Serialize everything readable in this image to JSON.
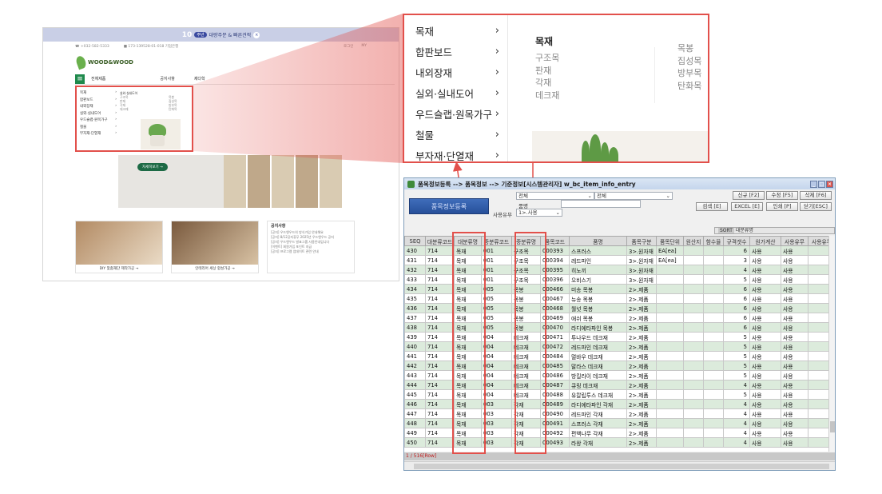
{
  "site": {
    "banner_num": "10",
    "banner_badge": "주년",
    "banner_text": "대량주문 & 빠른견적",
    "banner_close": "×",
    "phone": "☎ +032-582-5333",
    "account": "■ 173-139528-01-018 기업은행",
    "login": "로그인",
    "mypage": "MY",
    "logo_text": "WOOD&WOOD",
    "nav_all": "전체제품",
    "nav_notice": "공지사항",
    "nav_items": "제다학",
    "menu_title": "목재",
    "menu_items": [
      "목재",
      "합판보드",
      "내외장재",
      "실외·실내도어",
      "우드슬랩·원목가구",
      "철물",
      "부자재·단열재"
    ],
    "menu_sub": [
      "실외·실내도어",
      "구조목",
      "판재",
      "각재",
      "데크재"
    ],
    "menu_sub2": [
      "목봉",
      "집성목",
      "방부목",
      "탄화목"
    ],
    "hero_btn": "자세히보기 →",
    "card1": "DIY 맞춤재단 제작가공 →",
    "card2": "인테리어 세상 합성가공 →",
    "notice_title": "공지사항",
    "notices": [
      "[공지] 우드앤우드의 방식가입 안내해요",
      "[공지] 8/12공지휴무 2025년 우드앤우드 공지",
      "[공지] 우드앤우드 발표그룹 사용안내입니다",
      "[이벤트] 회원가입 포인트 지급",
      "[공지] 프로그램 업데이트 관련 안내"
    ]
  },
  "zoom": {
    "categories": [
      "목재",
      "합판보드",
      "내외장재",
      "실외·실내도어",
      "우드슬랩·원목가구",
      "철물",
      "부자재·단열재"
    ],
    "sub_title": "목재",
    "sub_items": [
      "구조목",
      "판재",
      "각재",
      "데크재"
    ],
    "sub_items2": [
      "목봉",
      "집성목",
      "방부목",
      "탄화목"
    ]
  },
  "erp": {
    "title": "품목정보등록 --> 품목정보 --> 기준정보[시스템관리자] w_bc_item_info_entry",
    "big_button": "품목정보등록",
    "filter1": "전체",
    "filter2": "전체",
    "name_label": "품명",
    "use_label": "사용유무",
    "use_value": "1>.사용",
    "buttons": [
      "신규 [F2]",
      "수정 [F5]",
      "삭제 [F6]",
      "검색 [E]",
      "EXCEL [E]",
      "인쇄 [P]",
      "닫기[ESC]"
    ],
    "sort_label": "SORT",
    "sort_value": "대분류명",
    "columns": [
      "SEQ",
      "대분류코드",
      "대분류명",
      "중분류코드",
      "중분류명",
      "품목코드",
      "품명",
      "품목구분",
      "품목단위",
      "원산지",
      "함수율",
      "규격갯수",
      "원가계산",
      "사용유무",
      "사용유무"
    ],
    "rows": [
      [
        "430",
        "714",
        "목재",
        "001",
        "구조목",
        "000393",
        "스프러스",
        "3>.원자재",
        "EA[ea]",
        "",
        "",
        "6",
        "사용",
        "사용"
      ],
      [
        "431",
        "714",
        "목재",
        "001",
        "구조목",
        "000394",
        "레드파인",
        "3>.원자재",
        "EA[ea]",
        "",
        "",
        "3",
        "사용",
        "사용"
      ],
      [
        "432",
        "714",
        "목재",
        "001",
        "구조목",
        "000395",
        "히노끼",
        "3>.원자재",
        "",
        "",
        "",
        "4",
        "사용",
        "사용"
      ],
      [
        "433",
        "714",
        "목재",
        "001",
        "구조목",
        "000396",
        "오비스기",
        "3>.원자재",
        "",
        "",
        "",
        "5",
        "사용",
        "사용"
      ],
      [
        "434",
        "714",
        "목재",
        "005",
        "목봉",
        "000466",
        "미송 목봉",
        "2>.제품",
        "",
        "",
        "",
        "6",
        "사용",
        "사용"
      ],
      [
        "435",
        "714",
        "목재",
        "005",
        "목봉",
        "000467",
        "뉴송 목봉",
        "2>.제품",
        "",
        "",
        "",
        "6",
        "사용",
        "사용"
      ],
      [
        "436",
        "714",
        "목재",
        "005",
        "목봉",
        "000468",
        "월넛 목봉",
        "2>.제품",
        "",
        "",
        "",
        "6",
        "사용",
        "사용"
      ],
      [
        "437",
        "714",
        "목재",
        "005",
        "목봉",
        "000469",
        "애쉬 목봉",
        "2>.제품",
        "",
        "",
        "",
        "6",
        "사용",
        "사용"
      ],
      [
        "438",
        "714",
        "목재",
        "005",
        "목봉",
        "000470",
        "라디에타파인 목봉",
        "2>.제품",
        "",
        "",
        "",
        "6",
        "사용",
        "사용"
      ],
      [
        "439",
        "714",
        "목재",
        "004",
        "데크재",
        "000471",
        "투나우드 데크재",
        "2>.제품",
        "",
        "",
        "",
        "5",
        "사용",
        "사용"
      ],
      [
        "440",
        "714",
        "목재",
        "004",
        "데크재",
        "000472",
        "레드파인 데크재",
        "2>.제품",
        "",
        "",
        "",
        "5",
        "사용",
        "사용"
      ],
      [
        "441",
        "714",
        "목재",
        "004",
        "데크재",
        "000484",
        "멀바우 데크재",
        "2>.제품",
        "",
        "",
        "",
        "5",
        "사용",
        "사용"
      ],
      [
        "442",
        "714",
        "목재",
        "004",
        "데크재",
        "000485",
        "말라스 데크재",
        "2>.제품",
        "",
        "",
        "",
        "5",
        "사용",
        "사용"
      ],
      [
        "443",
        "714",
        "목재",
        "004",
        "데크재",
        "000486",
        "방킬라이 데크재",
        "2>.제품",
        "",
        "",
        "",
        "5",
        "사용",
        "사용"
      ],
      [
        "444",
        "714",
        "목재",
        "004",
        "데크재",
        "000487",
        "큐링 데크재",
        "2>.제품",
        "",
        "",
        "",
        "4",
        "사용",
        "사용"
      ],
      [
        "445",
        "714",
        "목재",
        "004",
        "데크재",
        "000488",
        "유칼립투스 데크재",
        "2>.제품",
        "",
        "",
        "",
        "5",
        "사용",
        "사용"
      ],
      [
        "446",
        "714",
        "목재",
        "003",
        "각재",
        "000489",
        "라디에타파인 각재",
        "2>.제품",
        "",
        "",
        "",
        "4",
        "사용",
        "사용"
      ],
      [
        "447",
        "714",
        "목재",
        "003",
        "각재",
        "000490",
        "레드파인 각재",
        "2>.제품",
        "",
        "",
        "",
        "4",
        "사용",
        "사용"
      ],
      [
        "448",
        "714",
        "목재",
        "003",
        "각재",
        "000491",
        "스프러스 각재",
        "2>.제품",
        "",
        "",
        "",
        "4",
        "사용",
        "사용"
      ],
      [
        "449",
        "714",
        "목재",
        "003",
        "각재",
        "000492",
        "편백나무 각재",
        "2>.제품",
        "",
        "",
        "",
        "4",
        "사용",
        "사용"
      ],
      [
        "450",
        "714",
        "목재",
        "003",
        "각재",
        "000493",
        "라왕 각재",
        "2>.제품",
        "",
        "",
        "",
        "4",
        "사용",
        "사용"
      ]
    ],
    "status": "1 / 516[Row]"
  }
}
